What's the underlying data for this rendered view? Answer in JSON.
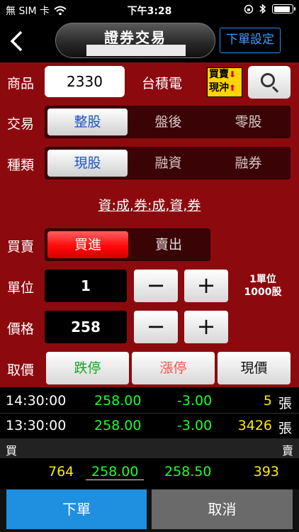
{
  "status": {
    "carrier": "無 SIM 卡",
    "time": "下午3:28"
  },
  "nav": {
    "title": "證券交易",
    "order_setting": "下單設定"
  },
  "form": {
    "product_label": "商品",
    "stock_code": "2330",
    "stock_name": "台積電",
    "daytrade_line1": "買賣",
    "daytrade_line2": "現沖",
    "trade_label": "交易",
    "trade_options": [
      "整股",
      "盤後",
      "零股"
    ],
    "trade_selected": "整股",
    "type_label": "種類",
    "type_options": [
      "現股",
      "融資",
      "融券"
    ],
    "type_selected": "現股",
    "credit_status": "資:成,券:成,資,券",
    "side_label": "買賣",
    "side_options": [
      "買進",
      "賣出"
    ],
    "side_selected": "買進",
    "unit_label": "單位",
    "unit_value": "1",
    "unit_note_line1": "1單位",
    "unit_note_line2": "1000股",
    "price_label": "價格",
    "price_value": "258",
    "pick_label": "取價",
    "pick_buttons": [
      "跌停",
      "漲停",
      "現價"
    ],
    "minus": "−",
    "plus": "+"
  },
  "ticks": [
    {
      "time": "14:30:00",
      "price": "258.00",
      "change": "-3.00",
      "volume": "5",
      "unit": "張"
    },
    {
      "time": "13:30:00",
      "price": "258.00",
      "change": "-3.00",
      "volume": "3426",
      "unit": "張"
    }
  ],
  "orderbook": {
    "buy_label": "買",
    "sell_label": "賣",
    "bid_volume": "764",
    "bid_price": "258.00",
    "ask_price": "258.50",
    "ask_volume": "393"
  },
  "actions": {
    "submit": "下單",
    "cancel": "取消"
  },
  "colors": {
    "form_bg": "#8c0a0e",
    "buy_red": "#ff0a0a",
    "selected_text_blue": "#1a54c4",
    "quote_green": "#1cff2c",
    "quote_yellow": "#ffea00",
    "submit_blue": "#1f8fe0"
  }
}
